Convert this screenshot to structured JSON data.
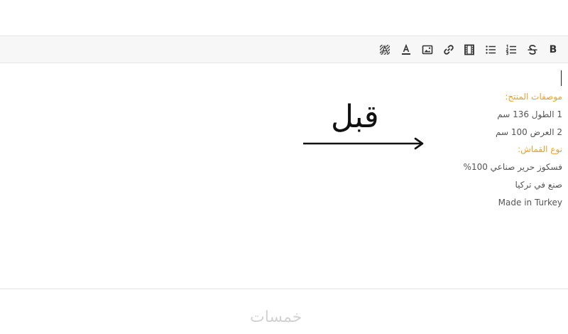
{
  "toolbar": {
    "buttons": [
      {
        "name": "highlight-button",
        "icon": "highlight-icon"
      },
      {
        "name": "font-color-button",
        "icon": "font-color-icon"
      },
      {
        "name": "insert-image-button",
        "icon": "image-icon"
      },
      {
        "name": "insert-link-button",
        "icon": "link-icon"
      },
      {
        "name": "insert-video-button",
        "icon": "film-icon"
      },
      {
        "name": "bullet-list-button",
        "icon": "bullet-list-icon"
      },
      {
        "name": "numbered-list-button",
        "icon": "numbered-list-icon"
      },
      {
        "name": "strikethrough-button",
        "icon": "strikethrough-icon"
      },
      {
        "name": "bold-button",
        "icon": "bold-icon",
        "label": "B"
      }
    ]
  },
  "content": {
    "lines": [
      {
        "text": "موصفات المنتج:",
        "style": "orange"
      },
      {
        "text": "1 الطول 136 سم",
        "style": "normal"
      },
      {
        "text": "2 العرض 100 سم",
        "style": "normal"
      },
      {
        "text": "نوع القماش:",
        "style": "orange"
      },
      {
        "text": "فسكوز حرير صناعي 100%",
        "style": "normal"
      },
      {
        "text": "صنع في تركيا",
        "style": "normal"
      },
      {
        "text": "Made in Turkey",
        "style": "normal"
      }
    ]
  },
  "annotation": {
    "text": "قبل",
    "arrow_direction": "right"
  },
  "watermark": {
    "text": "خمسات"
  },
  "colors": {
    "accent_orange": "#f0a02a",
    "text": "#555555",
    "toolbar_bg": "#f7f7f7"
  }
}
